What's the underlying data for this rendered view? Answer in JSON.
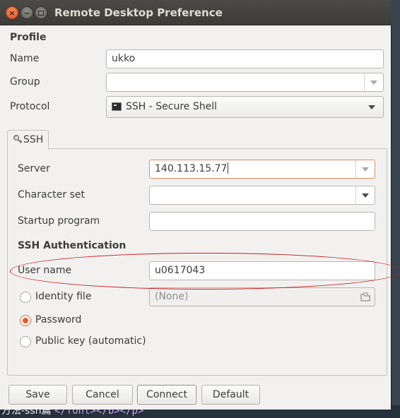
{
  "window": {
    "title": "Remote Desktop Preference",
    "controls": {
      "close": "×",
      "minimize": "−"
    }
  },
  "profile": {
    "section_title": "Profile",
    "name_label": "Name",
    "name_value": "ukko",
    "group_label": "Group",
    "group_value": "",
    "protocol_label": "Protocol",
    "protocol_value": "SSH - Secure Shell"
  },
  "tab": {
    "label": "SSH"
  },
  "ssh": {
    "server_label": "Server",
    "server_value": "140.113.15.77",
    "charset_label": "Character set",
    "charset_value": "",
    "startup_label": "Startup program",
    "startup_value": "",
    "auth_title": "SSH Authentication",
    "username_label": "User name",
    "username_value": "u0617043",
    "identity_label": "Identity file",
    "identity_value": "(None)",
    "password_label": "Password",
    "pubkey_label": "Public key (automatic)",
    "selected_auth": "Password"
  },
  "buttons": {
    "save": "Save",
    "cancel": "Cancel",
    "connect": "Connect",
    "default": "Default"
  },
  "background": {
    "partial_text": "方法-ssh篇",
    "partial_code": "</font></b></p>"
  },
  "colors": {
    "accent": "#e06030",
    "annotation": "#c91a1a",
    "titlebar": "#3c3b37"
  }
}
